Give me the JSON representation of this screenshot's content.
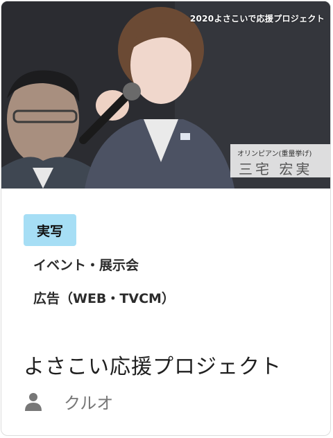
{
  "thumbnail": {
    "overlay_title": "2020よさこいで応援プロジェクト",
    "name_plate_sub": "オリンピアン(重量挙げ)",
    "name_plate_main": "三宅 宏実"
  },
  "badge": {
    "label": "実写",
    "color": "#a6def5"
  },
  "tags": [
    "イベント・展示会",
    "広告（WEB・TVCM）"
  ],
  "title": "よさこい応援プロジェクト",
  "author": {
    "icon": "person-icon",
    "name": "クルオ"
  }
}
